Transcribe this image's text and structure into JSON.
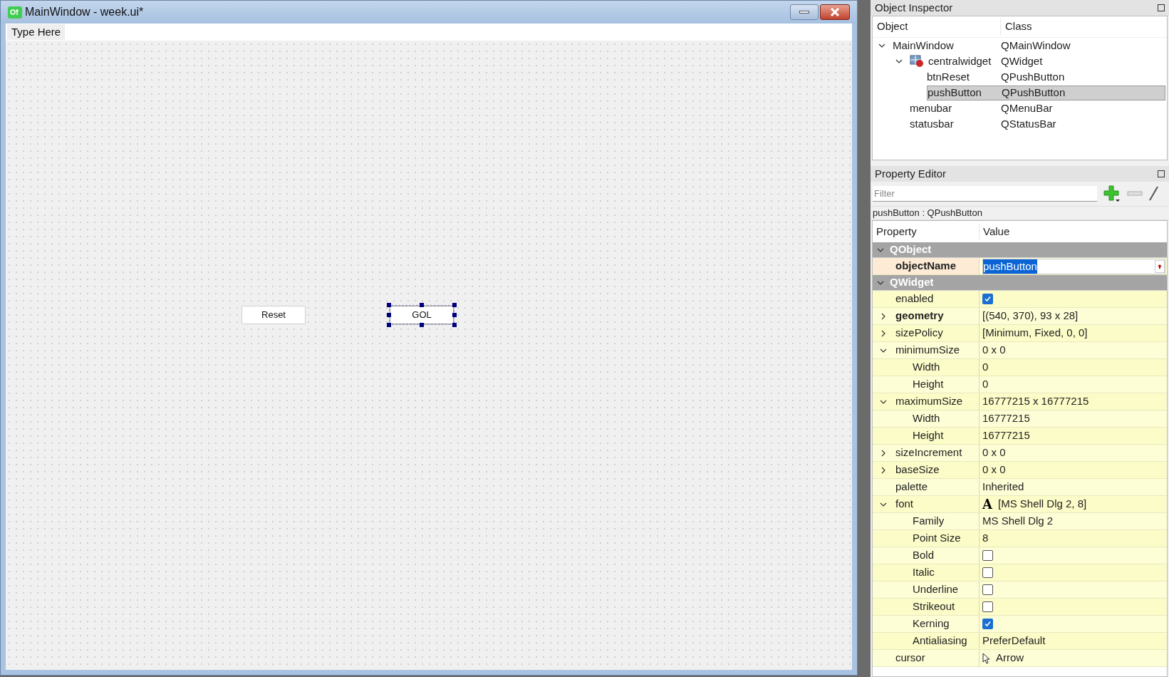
{
  "form_window": {
    "title": "MainWindow - week.ui*",
    "menu_placeholder": "Type Here",
    "buttons": [
      {
        "label": "Reset",
        "selected": false
      },
      {
        "label": "GOL",
        "selected": true
      }
    ]
  },
  "object_inspector": {
    "title": "Object Inspector",
    "columns": [
      "Object",
      "Class"
    ],
    "tree": [
      {
        "name": "MainWindow",
        "class": "QMainWindow",
        "selected": false,
        "expanded": true,
        "children": [
          {
            "name": "centralwidget",
            "class": "QWidget",
            "selected": false,
            "expanded": true,
            "children": [
              {
                "name": "btnReset",
                "class": "QPushButton",
                "selected": false
              },
              {
                "name": "pushButton",
                "class": "QPushButton",
                "selected": true
              }
            ]
          },
          {
            "name": "menubar",
            "class": "QMenuBar",
            "selected": false
          },
          {
            "name": "statusbar",
            "class": "QStatusBar",
            "selected": false
          }
        ]
      }
    ]
  },
  "property_editor": {
    "title": "Property Editor",
    "filter_placeholder": "Filter",
    "subject": "pushButton : QPushButton",
    "columns": [
      "Property",
      "Value"
    ],
    "groups": [
      {
        "name": "QObject",
        "expanded": true,
        "properties": [
          {
            "name": "objectName",
            "bold": true,
            "kind": "edit",
            "value": "pushButton"
          }
        ]
      },
      {
        "name": "QWidget",
        "expanded": true,
        "properties": [
          {
            "name": "enabled",
            "bold": false,
            "kind": "checkbox",
            "checked": true
          },
          {
            "name": "geometry",
            "bold": true,
            "kind": "text",
            "value": "[(540, 370), 93 x 28]",
            "expanded": false
          },
          {
            "name": "sizePolicy",
            "bold": false,
            "kind": "text",
            "value": "[Minimum, Fixed, 0, 0]",
            "expanded": false
          },
          {
            "name": "minimumSize",
            "bold": false,
            "kind": "text",
            "value": "0 x 0",
            "expanded": true,
            "children": [
              {
                "name": "Width",
                "bold": false,
                "kind": "text",
                "value": "0"
              },
              {
                "name": "Height",
                "bold": false,
                "kind": "text",
                "value": "0"
              }
            ]
          },
          {
            "name": "maximumSize",
            "bold": false,
            "kind": "text",
            "value": "16777215 x 16777215",
            "expanded": true,
            "children": [
              {
                "name": "Width",
                "bold": false,
                "kind": "text",
                "value": "16777215"
              },
              {
                "name": "Height",
                "bold": false,
                "kind": "text",
                "value": "16777215"
              }
            ]
          },
          {
            "name": "sizeIncrement",
            "bold": false,
            "kind": "text",
            "value": "0 x 0",
            "expanded": false
          },
          {
            "name": "baseSize",
            "bold": false,
            "kind": "text",
            "value": "0 x 0",
            "expanded": false
          },
          {
            "name": "palette",
            "bold": false,
            "kind": "text",
            "value": "Inherited"
          },
          {
            "name": "font",
            "bold": false,
            "kind": "font",
            "icon_text": "A",
            "value": "[MS Shell Dlg 2, 8]",
            "expanded": true,
            "children": [
              {
                "name": "Family",
                "bold": false,
                "kind": "text",
                "value": "MS Shell Dlg 2"
              },
              {
                "name": "Point Size",
                "bold": false,
                "kind": "text",
                "value": "8"
              },
              {
                "name": "Bold",
                "bold": false,
                "kind": "checkbox",
                "checked": false
              },
              {
                "name": "Italic",
                "bold": false,
                "kind": "checkbox",
                "checked": false
              },
              {
                "name": "Underline",
                "bold": false,
                "kind": "checkbox",
                "checked": false
              },
              {
                "name": "Strikeout",
                "bold": false,
                "kind": "checkbox",
                "checked": false
              },
              {
                "name": "Kerning",
                "bold": false,
                "kind": "checkbox",
                "checked": true
              },
              {
                "name": "Antialiasing",
                "bold": false,
                "kind": "text",
                "value": "PreferDefault"
              }
            ]
          },
          {
            "name": "cursor",
            "bold": false,
            "kind": "cursor",
            "value": "Arrow"
          }
        ]
      }
    ]
  }
}
